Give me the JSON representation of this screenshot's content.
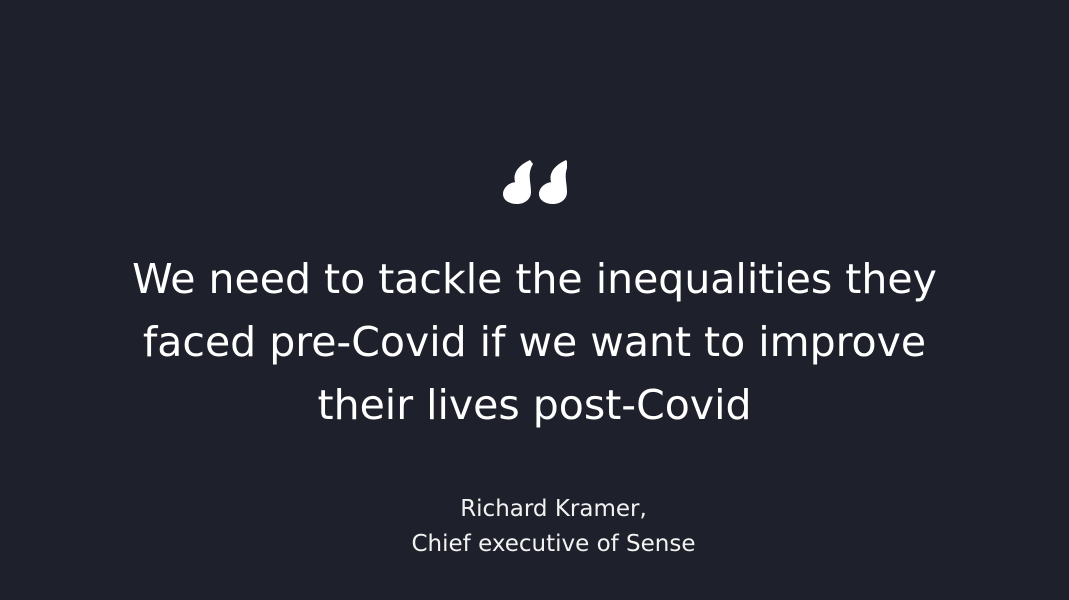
{
  "quote": {
    "lines": [
      "We need to tackle the inequalities they",
      "faced pre-Covid if we want to improve",
      "their lives post-Covid"
    ]
  },
  "attribution": {
    "name": "Richard Kramer,",
    "role": "Chief executive of Sense"
  },
  "icons": {
    "quote_mark": "opening-quote-icon"
  },
  "colors": {
    "background": "#1e212b",
    "text": "#ffffff"
  }
}
